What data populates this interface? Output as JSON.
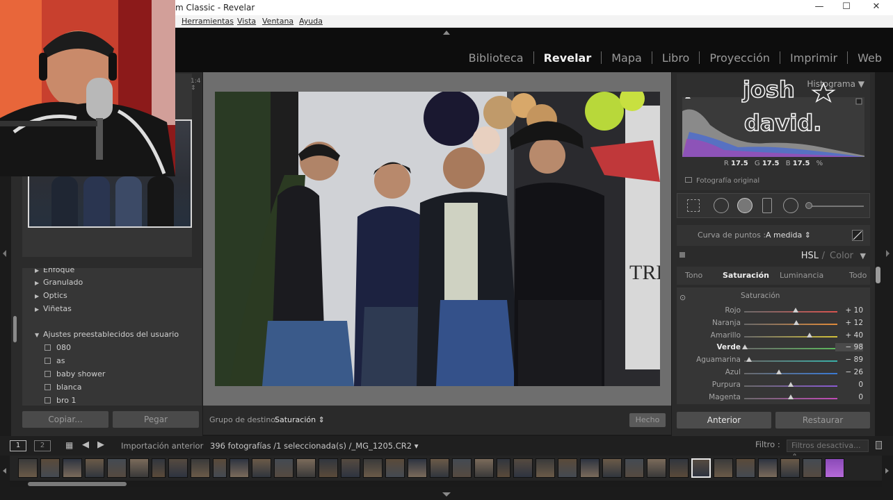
{
  "window": {
    "title": "m Classic - Revelar",
    "minimize": "—",
    "maximize": "☐",
    "close": "✕"
  },
  "menu": [
    "Herramientas",
    "Vista",
    "Ventana",
    "Ayuda"
  ],
  "modules": [
    {
      "label": "Biblioteca",
      "active": false
    },
    {
      "label": "Revelar",
      "active": true
    },
    {
      "label": "Mapa",
      "active": false
    },
    {
      "label": "Libro",
      "active": false
    },
    {
      "label": "Proyección",
      "active": false
    },
    {
      "label": "Imprimir",
      "active": false
    },
    {
      "label": "Web",
      "active": false
    }
  ],
  "navigator": {
    "zoom": "1:4 ⇕"
  },
  "presets": {
    "items": [
      {
        "label": "Enfoque",
        "type": "group"
      },
      {
        "label": "Granulado",
        "type": "group"
      },
      {
        "label": "Optics",
        "type": "group"
      },
      {
        "label": "Viñetas",
        "type": "group"
      },
      {
        "label": "Ajustes preestablecidos del usuario",
        "type": "open-group"
      },
      {
        "label": "080",
        "type": "preset"
      },
      {
        "label": "as",
        "type": "preset"
      },
      {
        "label": "baby shower",
        "type": "preset"
      },
      {
        "label": "blanca",
        "type": "preset"
      },
      {
        "label": "bro 1",
        "type": "preset"
      }
    ]
  },
  "left_buttons": {
    "copy": "Copiar...",
    "paste": "Pegar"
  },
  "center_toolbar": {
    "target_label": "Grupo de destino:",
    "target_value": "Saturación ⇕",
    "done": "Hecho"
  },
  "histogram": {
    "title": "Histograma",
    "r_label": "R",
    "r_value": "17.5",
    "g_label": "G",
    "g_value": "17.5",
    "b_label": "B",
    "b_value": "17.5",
    "unit": "%",
    "original_photo": "Fotografía original"
  },
  "curve": {
    "label": "Curva de puntos :",
    "value": "A medida ⇕"
  },
  "hsl": {
    "title_a": "HSL",
    "title_sep": "/",
    "title_b": "Color",
    "tabs": [
      {
        "label": "Tono",
        "active": false
      },
      {
        "label": "Saturación",
        "active": true
      },
      {
        "label": "Luminancia",
        "active": false
      },
      {
        "label": "Todo",
        "active": false
      }
    ],
    "section": "Saturación",
    "sliders": [
      {
        "name": "Rojo",
        "value": "+ 10",
        "num": 10,
        "color": "#d9534f",
        "bold": false
      },
      {
        "name": "Naranja",
        "value": "+ 12",
        "num": 12,
        "color": "#e08a3a",
        "bold": false
      },
      {
        "name": "Amarillo",
        "value": "+ 40",
        "num": 40,
        "color": "#d4c23a",
        "bold": false
      },
      {
        "name": "Verde",
        "value": "− 98",
        "num": -98,
        "color": "#5cb85c",
        "bold": true
      },
      {
        "name": "Aguamarina",
        "value": "− 89",
        "num": -89,
        "color": "#3ab0a8",
        "bold": false
      },
      {
        "name": "Azul",
        "value": "− 26",
        "num": -26,
        "color": "#3a7ad4",
        "bold": false
      },
      {
        "name": "Purpura",
        "value": "0",
        "num": 0,
        "color": "#8a5ad4",
        "bold": false
      },
      {
        "name": "Magenta",
        "value": "0",
        "num": 0,
        "color": "#c24ab8",
        "bold": false
      }
    ]
  },
  "right_buttons": {
    "previous": "Anterior",
    "reset": "Restaurar"
  },
  "filmstrip": {
    "page1": "1",
    "page2": "2",
    "source": "Importación anterior",
    "count": "396 fotografías /1 seleccionada(s) /_MG_1205.CR2 ▾",
    "filter_label": "Filtro :",
    "filter_value": "Filtros desactiva... ⇕",
    "thumb_count": 38
  },
  "watermark": {
    "line1": "josh",
    "line2": "david."
  },
  "colors": {
    "accent": "#e8e8e8",
    "panel": "#2b2b2b",
    "bg": "#1b1b1b"
  }
}
